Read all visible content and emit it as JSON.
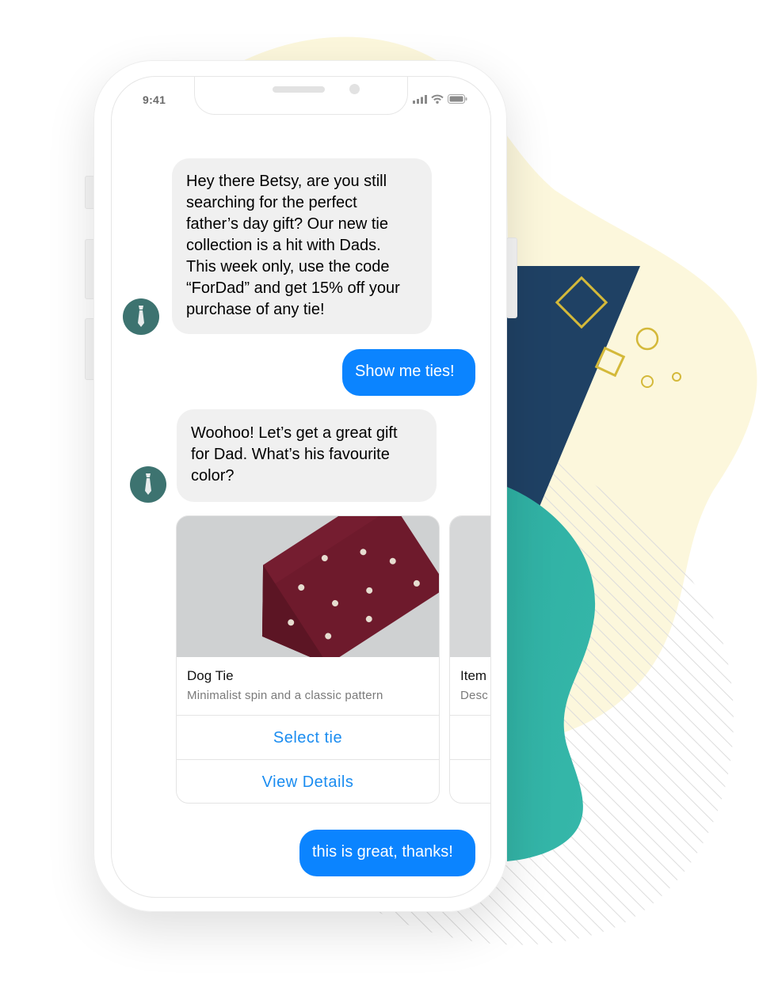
{
  "status_bar": {
    "time": "9:41",
    "icons": [
      "signal-icon",
      "wifi-icon",
      "battery-icon"
    ]
  },
  "colors": {
    "incoming_bubble": "#f0f0f0",
    "outgoing_bubble": "#0b84ff",
    "avatar": "#3d7370",
    "link": "#1a8cf0",
    "blob_yellow": "#fcf7dc",
    "panel_navy": "#1f4164",
    "blob_teal": "#33b3a6"
  },
  "bot": {
    "avatar_icon": "tie-icon"
  },
  "messages": [
    {
      "from": "bot",
      "lines": [
        "Hey there Betsy, are you still",
        "searching for the perfect",
        "father’s day gift? Our new tie",
        "collection is a hit with Dads.",
        "This week only, use the code",
        "“ForDad” and get 15% off your",
        "purchase of any tie!"
      ]
    },
    {
      "from": "user",
      "text": "Show me ties!"
    },
    {
      "from": "bot",
      "lines": [
        "Woohoo! Let’s get a great gift",
        "for Dad. What’s his favourite",
        "color?"
      ]
    },
    {
      "from": "user",
      "text": "this is great, thanks!"
    }
  ],
  "carousel": [
    {
      "title": "Dog Tie",
      "description": "Minimalist spin and a classic pattern",
      "image": "burgundy-dog-pattern-tie",
      "buttons": [
        "Select tie",
        "View Details"
      ]
    },
    {
      "title": "Item",
      "description": "Desc",
      "image": "gray-placeholder",
      "buttons": [
        "",
        ""
      ]
    }
  ]
}
